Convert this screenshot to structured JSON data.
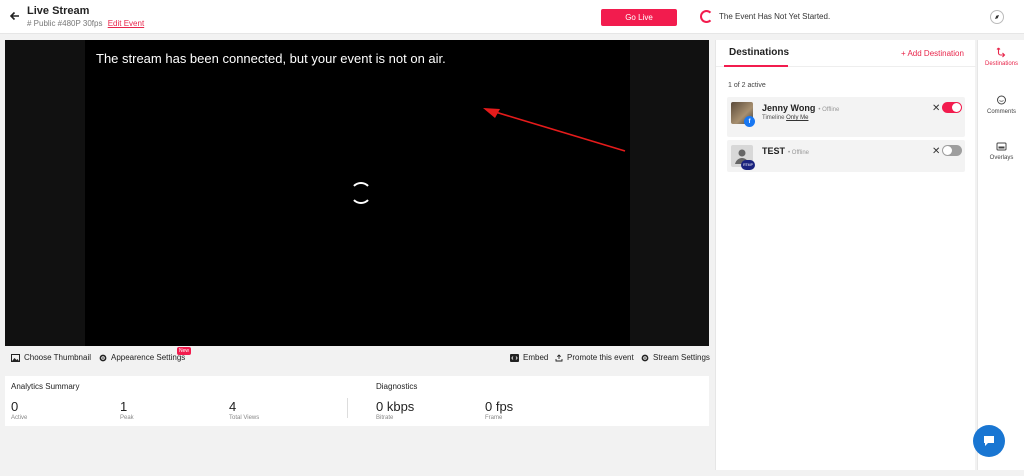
{
  "header": {
    "title": "Live Stream",
    "subline": "# Public #480P 30fps",
    "edit_label": "Edit Event",
    "go_live_label": "Go Live",
    "status_text": "The Event Has Not Yet Started."
  },
  "player": {
    "message": "The stream has been connected, but your event is not on air."
  },
  "toolbar": {
    "choose_thumbnail": "Choose Thumbnail",
    "appearance_settings": "Appearence Settings",
    "new_badge": "New",
    "embed": "Embed",
    "promote": "Promote this event",
    "stream_settings": "Stream Settings"
  },
  "analytics": {
    "title": "Analytics Summary",
    "metrics": [
      {
        "value": "0",
        "label": "Active"
      },
      {
        "value": "1",
        "label": "Peak"
      },
      {
        "value": "4",
        "label": "Total Views"
      }
    ]
  },
  "diagnostics": {
    "title": "Diagnostics",
    "metrics": [
      {
        "value": "0 kbps",
        "label": "Bitrate"
      },
      {
        "value": "0 fps",
        "label": "Frame"
      }
    ]
  },
  "destinations": {
    "title": "Destinations",
    "add_label": "+ Add Destination",
    "active_count": "1 of 2 active",
    "items": [
      {
        "name": "Jenny Wong",
        "status": "• Offline",
        "sub_prefix": "Timeline",
        "sub_link": "Only Me",
        "enabled": true
      },
      {
        "name": "TEST",
        "status": "• Offline",
        "enabled": false,
        "badge_text": "RTMP"
      }
    ]
  },
  "rail": {
    "items": [
      {
        "label": "Destinations"
      },
      {
        "label": "Comments"
      },
      {
        "label": "Overlays"
      }
    ]
  },
  "colors": {
    "accent": "#f21c4e",
    "facebook": "#1877f2",
    "chat_fab": "#1976d2"
  }
}
